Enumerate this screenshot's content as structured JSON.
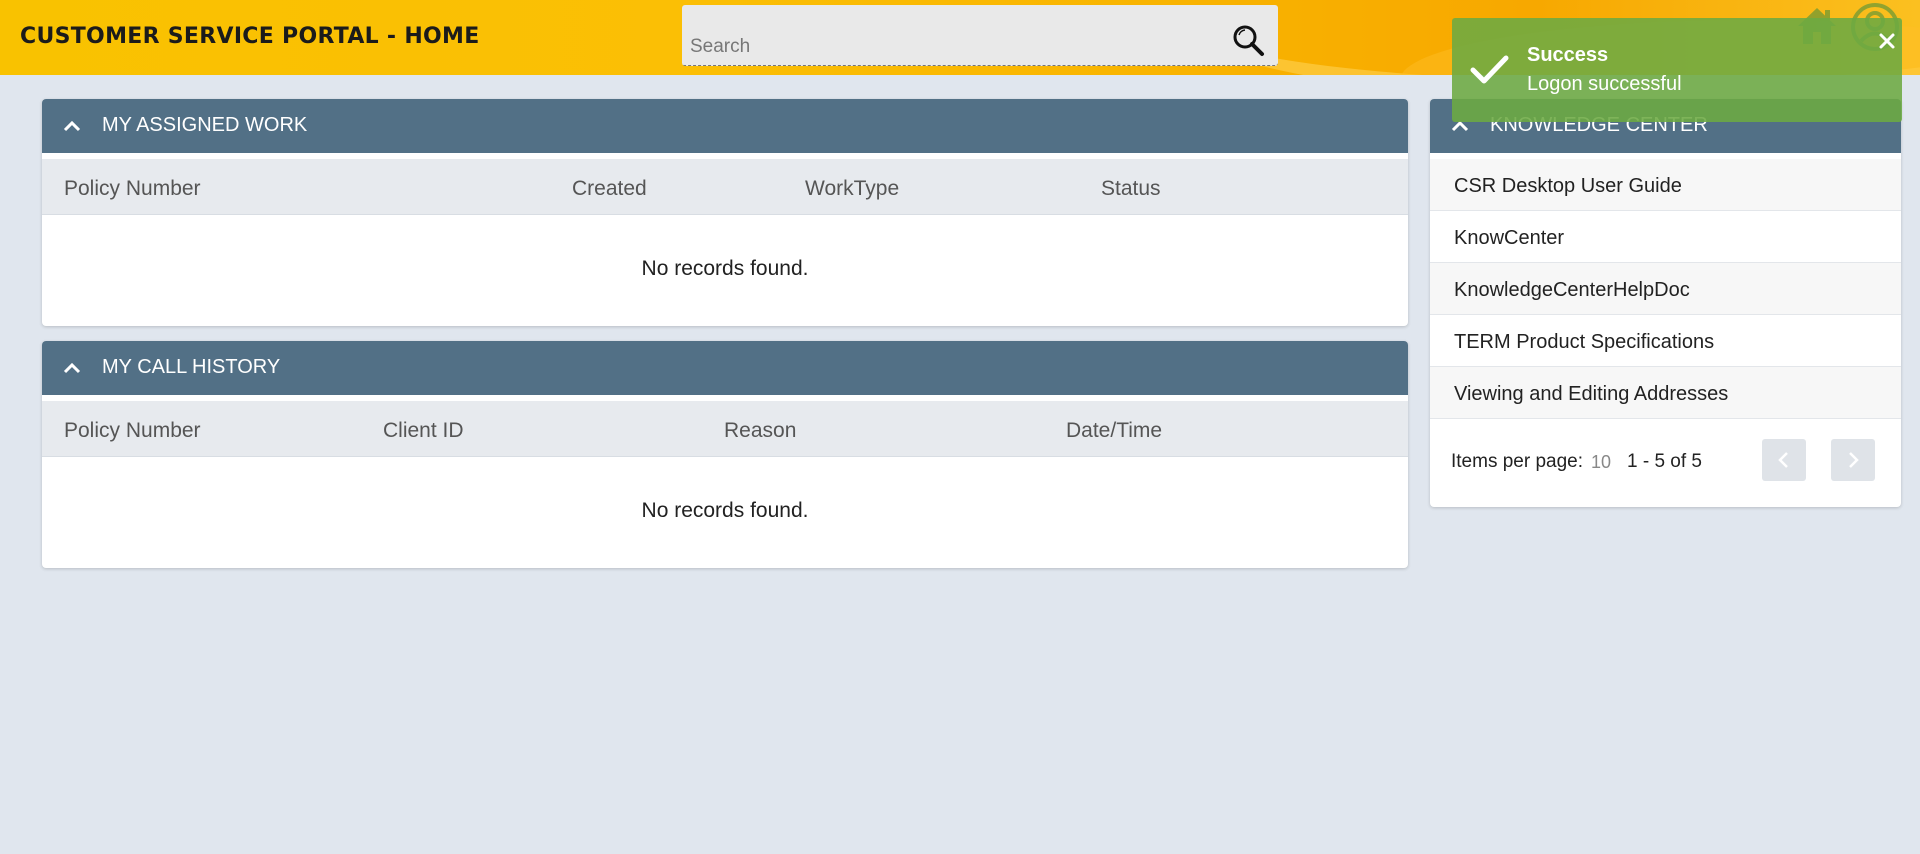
{
  "header": {
    "title": "CUSTOMER SERVICE PORTAL - HOME",
    "search_placeholder": "Search",
    "icons": [
      "search-icon",
      "home-icon",
      "user-icon"
    ]
  },
  "assigned_work": {
    "title": "MY ASSIGNED WORK",
    "columns": [
      "Policy Number",
      "Created",
      "WorkType",
      "Status"
    ],
    "empty_message": "No records found."
  },
  "call_history": {
    "title": "MY CALL HISTORY",
    "columns": [
      "Policy Number",
      "Client ID",
      "Reason",
      "Date/Time"
    ],
    "empty_message": "No records found."
  },
  "knowledge_center": {
    "title": "KNOWLEDGE CENTER",
    "items": [
      "CSR Desktop User Guide",
      "KnowCenter",
      "KnowledgeCenterHelpDoc",
      "TERM Product Specifications",
      "Viewing and Editing Addresses"
    ],
    "items_per_page_label": "Items per page:",
    "items_per_page_value": "10",
    "range": "1 - 5 of 5"
  },
  "toast": {
    "title": "Success",
    "message": "Logon successful"
  },
  "colors": {
    "header_yellow": "#f9c200",
    "panel_head": "#527086",
    "toast_green": "#6caa42",
    "page_bg": "#e0e6ee"
  }
}
